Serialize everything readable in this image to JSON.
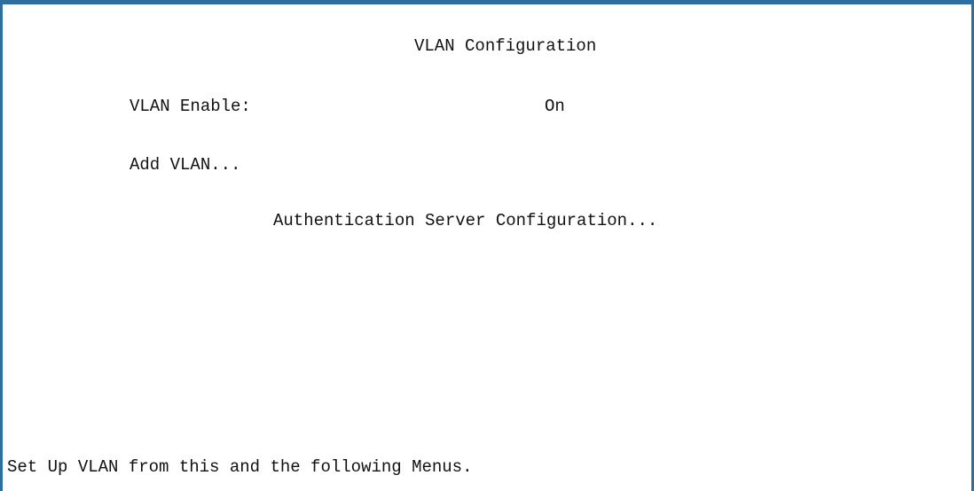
{
  "screen": {
    "title": "VLAN Configuration",
    "vlan_enable": {
      "label": "VLAN Enable:",
      "value": "On"
    },
    "menu_items": {
      "add_vlan": "Add VLAN...",
      "auth_server_config": "Authentication Server Configuration..."
    },
    "status_message": "Set Up VLAN from this and the following Menus."
  },
  "colors": {
    "frame_border": "#2f6fa0",
    "background": "#ffffff",
    "text": "#111111"
  }
}
